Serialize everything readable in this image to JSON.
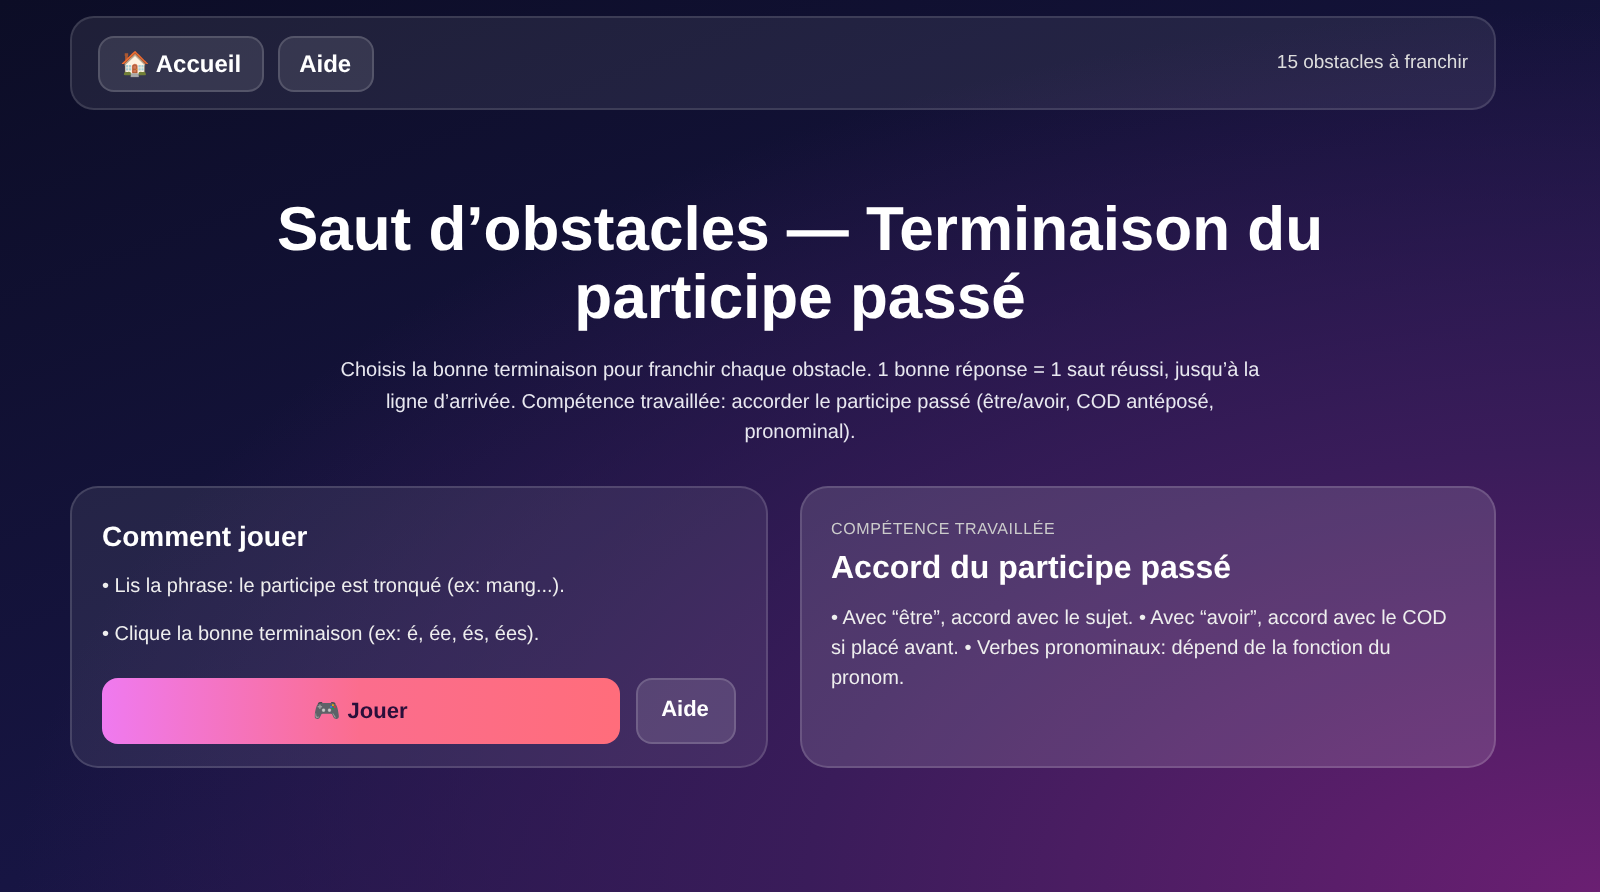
{
  "nav": {
    "buttons": [
      "🏠 Accueil",
      "Aide"
    ],
    "status": "15 obstacles à franchir"
  },
  "title": "Saut d’obstacles — Terminaison du participe passé",
  "intro": "Choisis la bonne terminaison pour franchir chaque obstacle. 1 bonne réponse = 1 saut réussi, jusqu’à la ligne d’arrivée. Compétence travaillée: accorder le participe passé (être/avoir, COD antéposé, pronominal).",
  "how_to": {
    "title": "Comment jouer",
    "steps": [
      "• Lis la phrase: le participe est tronqué (ex: mang...).",
      "• Clique la bonne terminaison (ex: é, ée, és, ées)."
    ],
    "buttons": [
      {
        "kind": "primary",
        "label": "🎮 Jouer"
      },
      {
        "kind": "secondary",
        "label": "Aide"
      }
    ]
  },
  "skill": {
    "eyebrow": "COMPÉTENCE TRAVAILLÉE",
    "title": "Accord du participe passé",
    "text": "• Avec “être”, accord avec le sujet. • Avec “avoir”, accord avec le COD si placé avant. • Verbes pronominaux: dépend de la fonction du pronom."
  }
}
